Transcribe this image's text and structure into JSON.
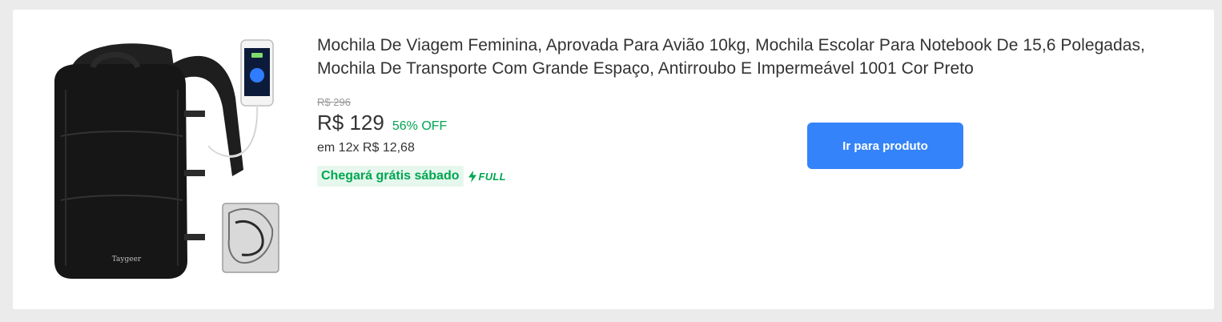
{
  "product": {
    "title": "Mochila De Viagem Feminina, Aprovada Para Avião 10kg, Mochila Escolar Para Notebook De 15,6 Polegadas, Mochila De Transporte Com Grande Espaço, Antirroubo E Impermeável 1001 Cor Preto",
    "old_price": "R$ 296",
    "price": "R$ 129",
    "discount": "56% OFF",
    "installments": "em 12x R$ 12,68",
    "shipping": "Chegará grátis sábado",
    "full_label": "FULL",
    "image_brand": "Taygeer",
    "button_label": "Ir para produto"
  },
  "colors": {
    "accent": "#3483fa",
    "green": "#00a650",
    "text": "#333333",
    "muted": "#999999"
  },
  "icons": {
    "product_image": "backpack-image",
    "full": "lightning-bolt-icon"
  }
}
